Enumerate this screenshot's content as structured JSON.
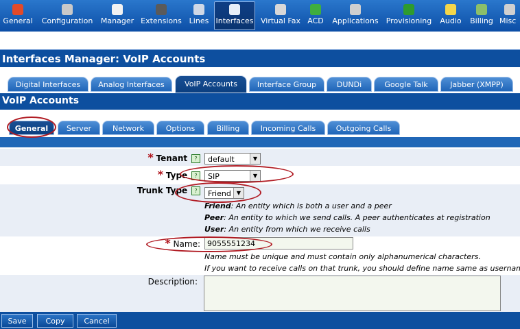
{
  "toolbar": {
    "items": [
      {
        "label": "General",
        "icon": "general-icon",
        "color": "#e24a2a"
      },
      {
        "label": "Configuration",
        "icon": "wrench-icon",
        "color": "#c9c9c9"
      },
      {
        "label": "Manager",
        "icon": "calendar-icon",
        "color": "#f2f2f2"
      },
      {
        "label": "Extensions",
        "icon": "book-icon",
        "color": "#5a5a5a"
      },
      {
        "label": "Lines",
        "icon": "phones-icon",
        "color": "#cfd8e6"
      },
      {
        "label": "Interfaces",
        "icon": "interface-icon",
        "color": "#e6eef8"
      },
      {
        "label": "Virtual Fax",
        "icon": "fax-icon",
        "color": "#d8d8d8"
      },
      {
        "label": "ACD",
        "icon": "acd-icon",
        "color": "#3fae3f"
      },
      {
        "label": "Applications",
        "icon": "tools-icon",
        "color": "#cfcfcf"
      },
      {
        "label": "Provisioning",
        "icon": "provisioning-icon",
        "color": "#2e9b2e"
      },
      {
        "label": "Audio",
        "icon": "speaker-icon",
        "color": "#f3d64a"
      },
      {
        "label": "Billing",
        "icon": "billing-icon",
        "color": "#8bbf6a"
      },
      {
        "label": "Misc",
        "icon": "misc-icon",
        "color": "#d0d0d0"
      }
    ]
  },
  "header1": {
    "title": "Interfaces Manager:  VoIP Accounts"
  },
  "tabs1": [
    "Digital Interfaces",
    "Analog Interfaces",
    "VoIP Accounts",
    "Interface Group",
    "DUNDi",
    "Google Talk",
    "Jabber (XMPP)"
  ],
  "header2": {
    "title": "VoIP Accounts"
  },
  "tabs2": [
    "General",
    "Server",
    "Network",
    "Options",
    "Billing",
    "Incoming Calls",
    "Outgoing Calls"
  ],
  "form": {
    "tenant": {
      "label": "Tenant",
      "value": "default"
    },
    "type": {
      "label": "Type",
      "value": "SIP"
    },
    "trunk_type": {
      "label": "Trunk Type",
      "value": "Friend"
    },
    "friend_desc": {
      "term": "Friend",
      "text": ": An entity which is both a user and a peer"
    },
    "peer_desc": {
      "term": "Peer",
      "text": ": An entity to which we send calls. A peer authenticates at registration"
    },
    "user_desc": {
      "term": "User",
      "text": ": An entity from which we receive calls"
    },
    "name": {
      "label": "Name",
      "value": "9055551234"
    },
    "name_hint1": "Name must be unique and must contain only alphanumerical characters.",
    "name_hint2": "If you want to receive calls on that trunk, you should define name same as username",
    "description": {
      "label": "Description:"
    }
  },
  "buttons": {
    "save": "Save",
    "copy": "Copy",
    "cancel": "Cancel"
  },
  "colors": {
    "brand_blue": "#0d4f9f",
    "highlight_red": "#b11c24"
  }
}
